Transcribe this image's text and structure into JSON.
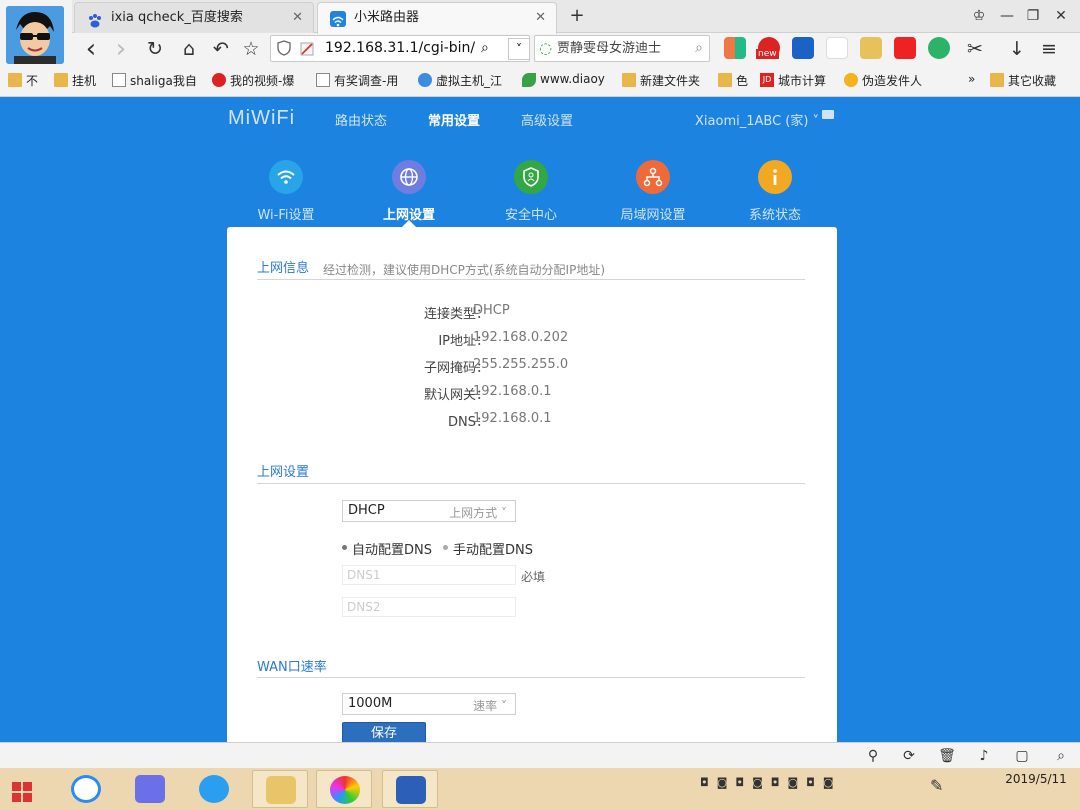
{
  "browser": {
    "tabs": [
      {
        "title": "ixia qcheck_百度搜索",
        "close": "✕"
      },
      {
        "title": "小米路由器",
        "close": "✕"
      }
    ],
    "new_tab": "+",
    "window_controls": {
      "skin": "♔",
      "min": "—",
      "max": "❐",
      "close": "✕"
    },
    "nav": {
      "back": "‹",
      "forward": "›",
      "reload": "↻",
      "home": "⌂",
      "undo": "↶",
      "star": "☆"
    },
    "url": "192.168.31.1/cgi-bin/",
    "search_text": "贾静雯母女游迪士",
    "bookmarks": [
      {
        "label": "不",
        "icon": "folder-icon"
      },
      {
        "label": "挂机",
        "icon": "folder-icon"
      },
      {
        "label": "shaliga我自",
        "icon": "page-icon"
      },
      {
        "label": "我的视频-爆",
        "icon": "red-circle-icon"
      },
      {
        "label": "有奖调查-用",
        "icon": "page-icon"
      },
      {
        "label": "虚拟主机_江",
        "icon": "globe-icon"
      },
      {
        "label": "www.diaoy",
        "icon": "leaf-icon"
      },
      {
        "label": "新建文件夹",
        "icon": "folder-icon"
      },
      {
        "label": "色",
        "icon": "folder-icon"
      },
      {
        "label": "城市计算",
        "icon": "jd-icon"
      },
      {
        "label": "伪造发件人",
        "icon": "bulb-icon"
      },
      {
        "label": "»",
        "icon": ""
      },
      {
        "label": "其它收藏",
        "icon": "folder-icon"
      }
    ],
    "jd_text": "JD",
    "new_badge": "new"
  },
  "router": {
    "logo": "MiWiFi",
    "topnav": [
      "路由状态",
      "常用设置",
      "高级设置"
    ],
    "device": "Xiaomi_1ABC (家) ˅",
    "categories": [
      {
        "label": "Wi-Fi设置",
        "color": "#29a4e8",
        "icon": "wifi-icon"
      },
      {
        "label": "上网设置",
        "color": "#6f7de0",
        "icon": "globe-icon"
      },
      {
        "label": "安全中心",
        "color": "#31a843",
        "icon": "shield-icon"
      },
      {
        "label": "局域网设置",
        "color": "#ee6a3a",
        "icon": "network-icon"
      },
      {
        "label": "系统状态",
        "color": "#f3a821",
        "icon": "info-icon"
      }
    ],
    "info": {
      "title": "上网信息",
      "hint": "经过检测，建议使用DHCP方式(系统自动分配IP地址)",
      "rows": [
        {
          "k": "连接类型：",
          "v": "DHCP"
        },
        {
          "k": "IP地址：",
          "v": "192.168.0.202"
        },
        {
          "k": "子网掩码：",
          "v": "255.255.255.0"
        },
        {
          "k": "默认网关：",
          "v": "192.168.0.1"
        },
        {
          "k": "DNS：",
          "v": "192.168.0.1"
        }
      ]
    },
    "settings": {
      "title": "上网设置",
      "mode_value": "DHCP",
      "mode_hint": "上网方式",
      "radio_auto": "自动配置DNS",
      "radio_manual": "手动配置DNS",
      "dns1_placeholder": "DNS1",
      "dns2_placeholder": "DNS2",
      "required": "必填"
    },
    "wan": {
      "title": "WAN口速率",
      "speed_value": "1000M",
      "speed_hint": "速率",
      "save": "保存"
    }
  },
  "statusbar": {
    "icons": [
      "pin-icon",
      "refresh-icon",
      "trash-icon",
      "speaker-icon",
      "window-icon",
      "zoom-icon"
    ]
  },
  "taskbar": {
    "clock_time": "",
    "clock_date": "2019/5/11"
  }
}
